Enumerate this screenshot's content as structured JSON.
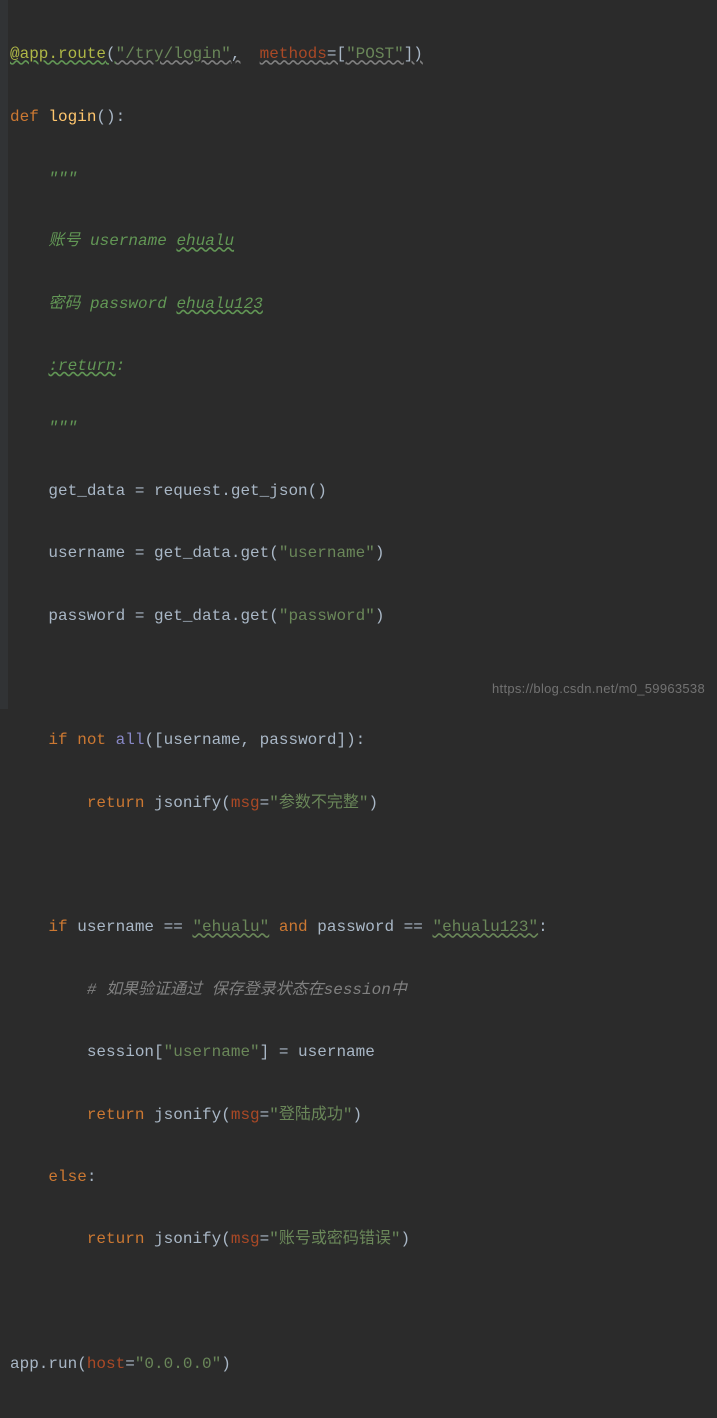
{
  "code": {
    "l1": {
      "dec": "@app.route",
      "p1": "(",
      "s1": "\"/try/login\"",
      "c": ",",
      "sp": "  ",
      "kw": "methods",
      "eq": "=[",
      "s2": "\"POST\"",
      "p2": "])"
    },
    "l2": {
      "def": "def ",
      "name": "login",
      "p": "():"
    },
    "l3": "    \"\"\"",
    "l4": {
      "pre": "    ",
      "txt1": "账号 username ",
      "txt2": "ehualu"
    },
    "l5": {
      "pre": "    ",
      "txt1": "密码 password ",
      "txt2": "ehualu123"
    },
    "l6": {
      "pre": "    ",
      "ret": ":return",
      "colon": ":"
    },
    "l7": "    \"\"\"",
    "l8": {
      "pre": "    ",
      "t": "get_data = request.get_json()"
    },
    "l9": {
      "pre": "    ",
      "t1": "username = get_data.get(",
      "s": "\"username\"",
      "t2": ")"
    },
    "l10": {
      "pre": "    ",
      "t1": "password = get_data.get(",
      "s": "\"password\"",
      "t2": ")"
    },
    "l11": {
      "pre": "    ",
      "if": "if ",
      "not": "not ",
      "all": "all",
      "args": "([username",
      "comma": ",",
      "args2": " password]):"
    },
    "l12": {
      "pre": "        ",
      "ret": "return ",
      "fn": "jsonify(",
      "kw": "msg",
      "eq": "=",
      "s": "\"参数不完整\"",
      "p": ")"
    },
    "l13": {
      "pre": "    ",
      "if": "if ",
      "t1": "username == ",
      "s1": "\"ehualu\"",
      "and": " and ",
      "t2": "password == ",
      "s2": "\"ehualu123\"",
      "colon": ":"
    },
    "l14": {
      "pre": "        ",
      "c": "# 如果验证通过 保存登录状态在session中"
    },
    "l15": {
      "pre": "        ",
      "t1": "session[",
      "s": "\"username\"",
      "t2": "] = username"
    },
    "l16": {
      "pre": "        ",
      "ret": "return ",
      "fn": "jsonify(",
      "kw": "msg",
      "eq": "=",
      "s": "\"登陆成功\"",
      "p": ")"
    },
    "l17": {
      "pre": "    ",
      "else": "else",
      "colon": ":"
    },
    "l18": {
      "pre": "        ",
      "ret": "return ",
      "fn": "jsonify(",
      "kw": "msg",
      "eq": "=",
      "s": "\"账号或密码错误\"",
      "p": ")"
    },
    "l19": {
      "t1": "app.run(",
      "kw": "host",
      "eq": "=",
      "s": "\"0.0.0.0\"",
      "p": ")"
    }
  },
  "watermark": "https://blog.csdn.net/m0_59963538"
}
